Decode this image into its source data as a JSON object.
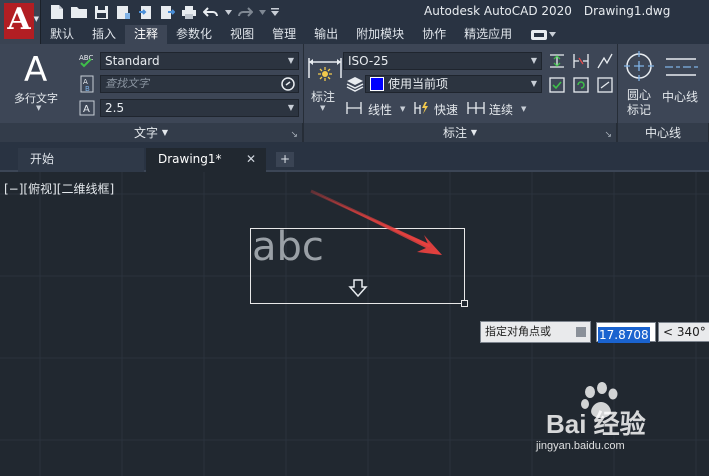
{
  "window": {
    "app_title": "Autodesk AutoCAD 2020",
    "doc_title": "Drawing1.dwg",
    "app_logo_letter": "A"
  },
  "ribbon_tabs": [
    {
      "label": "默认"
    },
    {
      "label": "插入"
    },
    {
      "label": "注释",
      "active": true
    },
    {
      "label": "参数化"
    },
    {
      "label": "视图"
    },
    {
      "label": "管理"
    },
    {
      "label": "输出"
    },
    {
      "label": "附加模块"
    },
    {
      "label": "协作"
    },
    {
      "label": "精选应用"
    }
  ],
  "text_panel": {
    "title": "文字",
    "big_button_glyph": "A",
    "big_button_label": "多行文字",
    "style_value": "Standard",
    "search_placeholder": "查找文字",
    "height_value": "2.5"
  },
  "dim_panel": {
    "title": "标注",
    "big_button_label": "标注",
    "dimstyle_value": "ISO-25",
    "layer_value": "使用当前项",
    "layer_color": "#0000ff",
    "linear_label": "线性",
    "quick_label": "快速",
    "continue_label": "连续"
  },
  "centerline_panel": {
    "title": "中心线",
    "center_mark_label": "圆心\n标记",
    "centerline_label": "中心线"
  },
  "doc_tabs": [
    {
      "label": "开始"
    },
    {
      "label": "Drawing1*",
      "active": true,
      "close": "✕"
    }
  ],
  "doc_tab_add": "+",
  "canvas": {
    "viewport_label": "[−][俯视][二维线框]",
    "text_object": "abc",
    "prompt": "指定对角点或",
    "input_value": "17.8708",
    "angle_value": "< 340°"
  },
  "watermark": {
    "main": "Bai 经验",
    "sub": "jingyan.baidu.com"
  },
  "colors": {
    "accent_red": "#e8413f",
    "ribbon_bg": "#3d4656",
    "canvas_bg": "#212830"
  }
}
